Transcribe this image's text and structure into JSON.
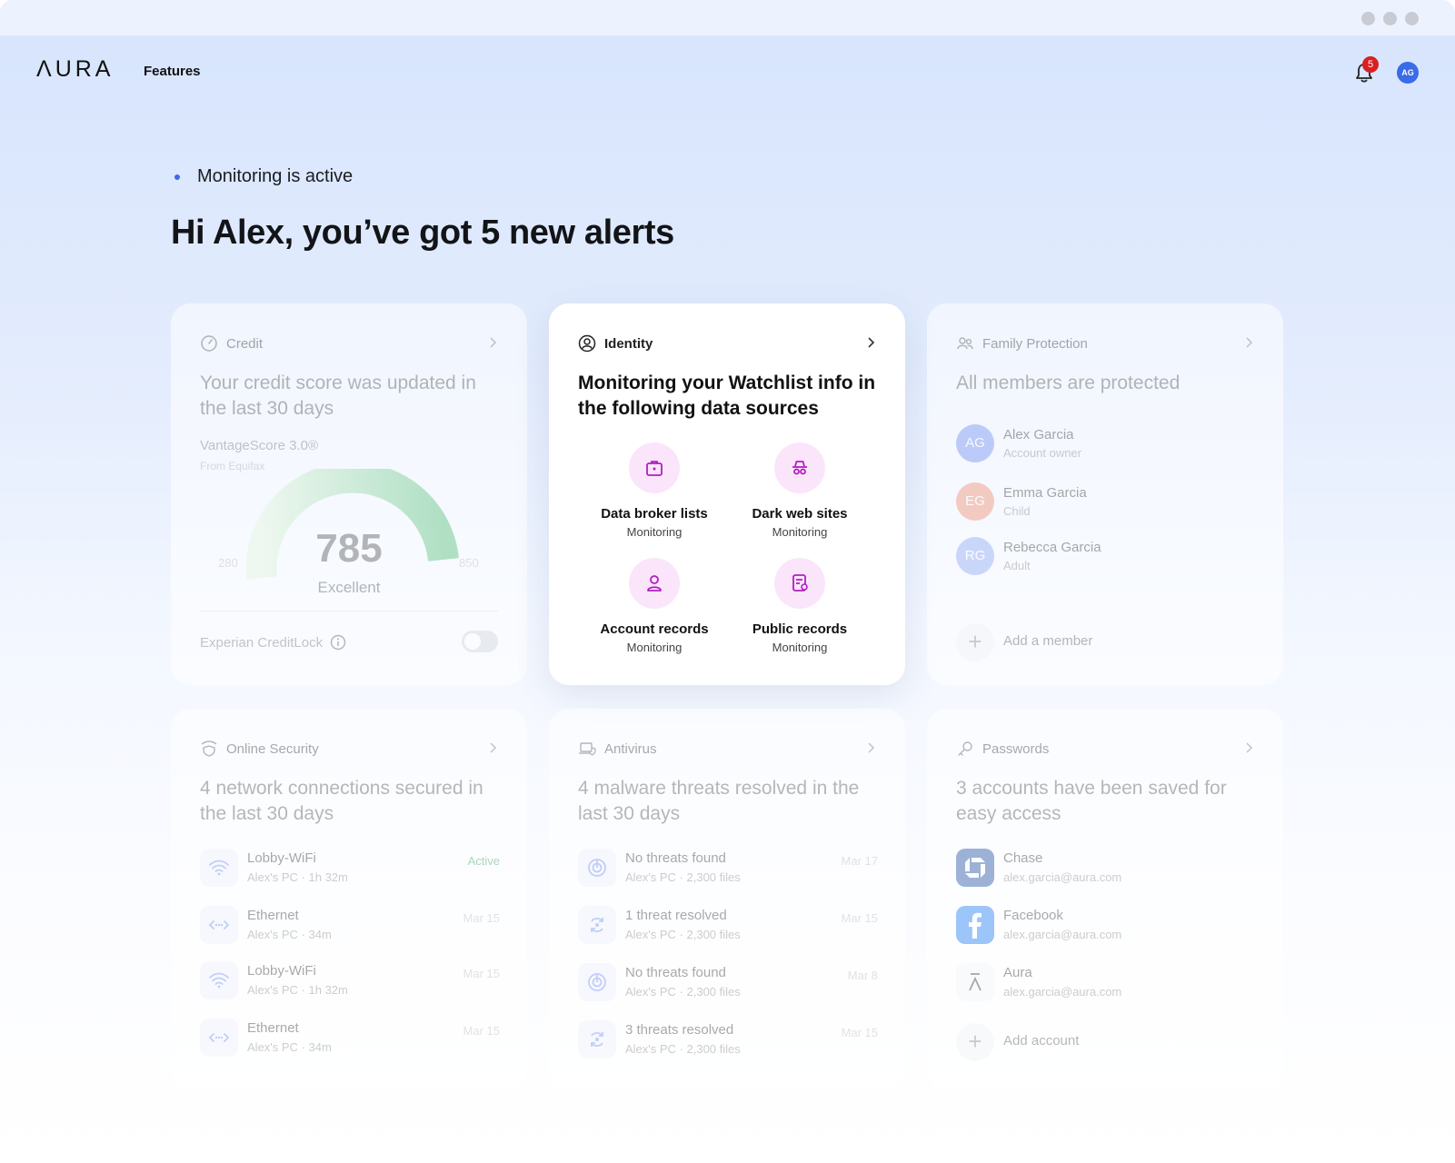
{
  "app": {
    "logo": "ΛURA",
    "nav_features": "Features",
    "notification_count": "5",
    "user_initials": "AG"
  },
  "colors": {
    "accent": "#3a6be8",
    "badge": "#d92020",
    "identity_icon_bg": "#fbe5fb",
    "identity_icon": "#b01ec0",
    "active_green": "#3aa25e"
  },
  "hero": {
    "status": "Monitoring is active",
    "headline": "Hi Alex, you’ve got 5 new alerts"
  },
  "credit": {
    "label": "Credit",
    "title": "Your credit score was updated in the last 30 days",
    "model": "VantageScore 3.0®",
    "source": "From Equifax",
    "score": "785",
    "rating": "Excellent",
    "min": "280",
    "max": "850",
    "lock_label": "Experian CreditLock"
  },
  "identity": {
    "label": "Identity",
    "title": "Monitoring your Watchlist info in the following data sources",
    "sources": [
      {
        "name": "Data broker lists",
        "status": "Monitoring",
        "icon": "briefcase-icon"
      },
      {
        "name": "Dark web sites",
        "status": "Monitoring",
        "icon": "spy-icon"
      },
      {
        "name": "Account records",
        "status": "Monitoring",
        "icon": "person-icon"
      },
      {
        "name": "Public records",
        "status": "Monitoring",
        "icon": "document-icon"
      }
    ]
  },
  "family": {
    "label": "Family Protection",
    "title": "All members are protected",
    "members": [
      {
        "initials": "AG",
        "name": "Alex Garcia",
        "role": "Account owner",
        "color": "#6e8df2"
      },
      {
        "initials": "EG",
        "name": "Emma Garcia",
        "role": "Child",
        "color": "#f08a6e"
      },
      {
        "initials": "RG",
        "name": "Rebecca Garcia",
        "role": "Adult",
        "color": "#8aa6f5"
      }
    ],
    "add_label": "Add a member"
  },
  "online_security": {
    "label": "Online Security",
    "title": "4 network connections secured in the last 30 days",
    "rows": [
      {
        "name": "Lobby-WiFi",
        "sub": "Alex's PC · 1h 32m",
        "right": "Active",
        "icon": "wifi-icon"
      },
      {
        "name": "Ethernet",
        "sub": "Alex's PC · 34m",
        "right": "Mar 15",
        "icon": "ethernet-icon"
      },
      {
        "name": "Lobby-WiFi",
        "sub": "Alex's PC · 1h 32m",
        "right": "Mar 15",
        "icon": "wifi-icon"
      },
      {
        "name": "Ethernet",
        "sub": "Alex's PC · 34m",
        "right": "Mar 15",
        "icon": "ethernet-icon"
      }
    ]
  },
  "antivirus": {
    "label": "Antivirus",
    "title": "4 malware threats resolved in the last 30 days",
    "rows": [
      {
        "name": "No threats found",
        "sub": "Alex's PC · 2,300 files",
        "right": "Mar 17",
        "icon": "scan-icon"
      },
      {
        "name": "1 threat resolved",
        "sub": "Alex's PC · 2,300 files",
        "right": "Mar 15",
        "icon": "bug-icon"
      },
      {
        "name": "No threats found",
        "sub": "Alex's PC · 2,300 files",
        "right": "Mar 8",
        "icon": "scan-icon"
      },
      {
        "name": "3 threats resolved",
        "sub": "Alex's PC · 2,300 files",
        "right": "Mar 15",
        "icon": "bug-icon"
      }
    ]
  },
  "passwords": {
    "label": "Passwords",
    "title": "3 accounts have been saved for easy access",
    "accounts": [
      {
        "name": "Chase",
        "email": "alex.garcia@aura.com",
        "icon": "chase-logo-icon"
      },
      {
        "name": "Facebook",
        "email": "alex.garcia@aura.com",
        "icon": "facebook-logo-icon"
      },
      {
        "name": "Aura",
        "email": "alex.garcia@aura.com",
        "icon": "aura-logo-icon"
      }
    ],
    "add_label": "Add account"
  }
}
